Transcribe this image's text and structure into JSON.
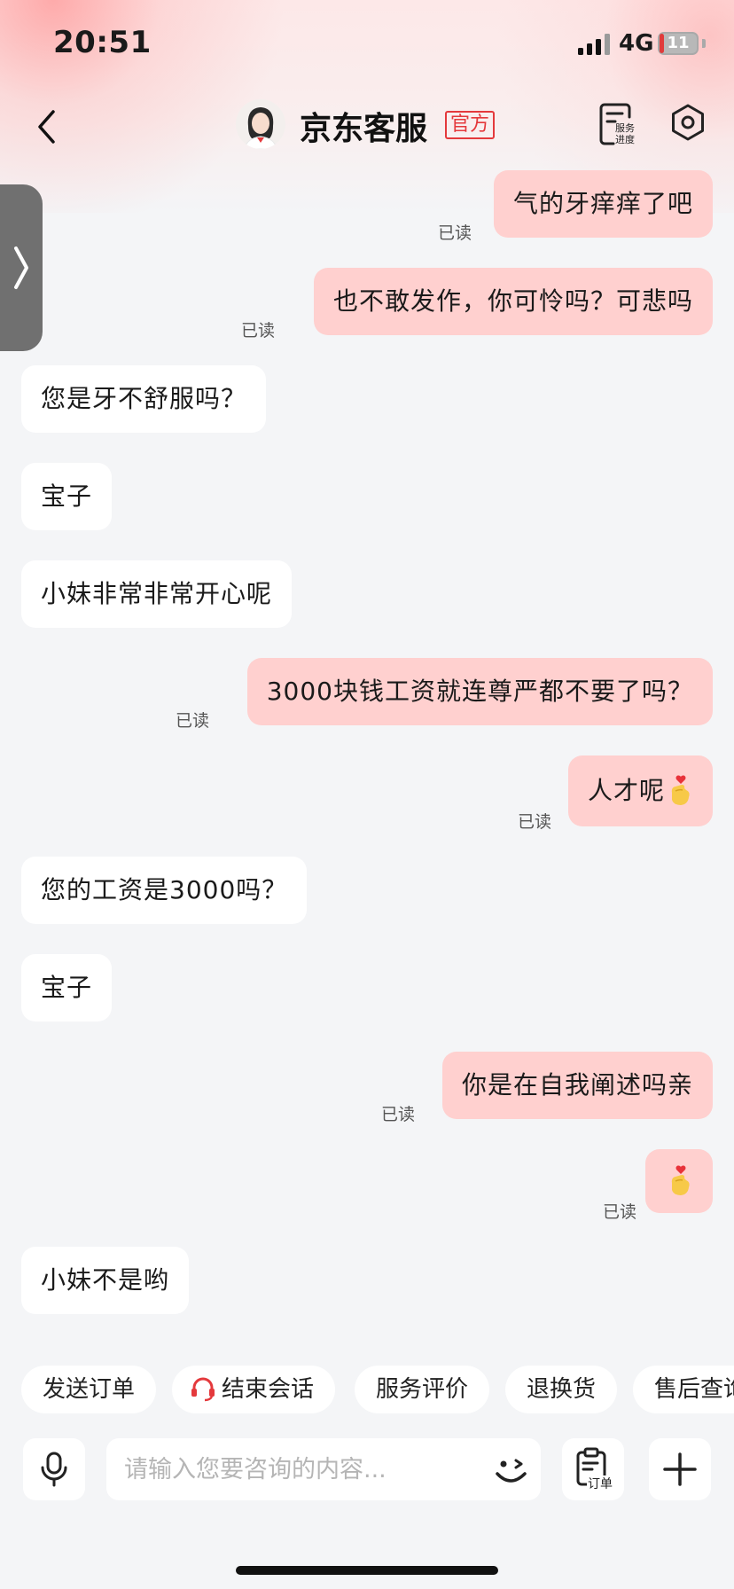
{
  "status_bar": {
    "time": "20:51",
    "network": "4G",
    "battery_level": "11",
    "battery_fraction": 0.11
  },
  "header": {
    "title": "京东客服",
    "badge": "官方",
    "service_progress_label_1": "服务",
    "service_progress_label_2": "进度"
  },
  "read_label": "已读",
  "messages": [
    {
      "side": "out",
      "text": "气的牙痒痒了吧",
      "read": "已读"
    },
    {
      "side": "out",
      "text": "也不敢发作，你可怜吗？可悲吗",
      "read": "已读"
    },
    {
      "side": "in",
      "text": "您是牙不舒服吗？"
    },
    {
      "side": "in",
      "text": "宝子"
    },
    {
      "side": "in",
      "text": "小妹非常非常开心呢"
    },
    {
      "side": "out",
      "text": "3000块钱工资就连尊严都不要了吗？",
      "read": "已读"
    },
    {
      "side": "out",
      "text": "人才呢",
      "emoji": "finger-heart",
      "read": "已读"
    },
    {
      "side": "in",
      "text": "您的工资是3000吗？"
    },
    {
      "side": "in",
      "text": "宝子"
    },
    {
      "side": "out",
      "text": "你是在自我阐述吗亲",
      "read": "已读"
    },
    {
      "side": "out",
      "text": "",
      "emoji": "finger-heart",
      "read": "已读"
    },
    {
      "side": "in",
      "text": "小妹不是哟"
    }
  ],
  "quick_actions": [
    "发送订单",
    "结束会话",
    "服务评价",
    "退换货",
    "售后查询"
  ],
  "input": {
    "placeholder": "请输入您要咨询的内容..."
  },
  "order_button_label": "订单",
  "colors": {
    "accent": "#e4393c",
    "bubble_out": "#ffd0cf",
    "bubble_in": "#ffffff",
    "background": "#f4f5f7"
  }
}
